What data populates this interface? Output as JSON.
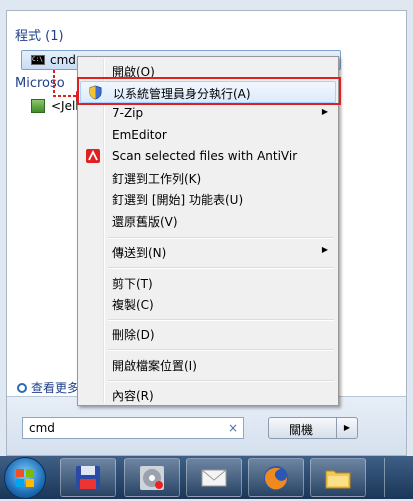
{
  "start_menu": {
    "programs_heading": "程式 (1)",
    "result_item": {
      "icon": "cmd-icon",
      "icon_text": "C:\\",
      "label": "cmd"
    },
    "files_heading_partial": "Microso",
    "file_item_partial": "<Jell",
    "see_more_partial": "查看更多",
    "search": {
      "value": "cmd",
      "clear_symbol": "×"
    },
    "shutdown": {
      "label": "關機",
      "arrow": "▶"
    }
  },
  "context_menu": {
    "items": [
      {
        "label": "開啟(O)",
        "icon": ""
      },
      {
        "label": "以系統管理員身分執行(A)",
        "icon": "shield-icon",
        "highlight": true
      },
      {
        "label": "7-Zip",
        "submenu": true
      },
      {
        "label": "EmEditor"
      },
      {
        "label": "Scan selected files with AntiVir",
        "icon": "antivir-icon"
      },
      {
        "label": "釘選到工作列(K)"
      },
      {
        "label": "釘選到 [開始] 功能表(U)"
      },
      {
        "label": "還原舊版(V)"
      },
      {
        "label": "傳送到(N)",
        "submenu": true
      },
      {
        "label": "剪下(T)"
      },
      {
        "label": "複製(C)"
      },
      {
        "label": "刪除(D)"
      },
      {
        "label": "開啟檔案位置(I)"
      },
      {
        "label": "內容(R)"
      }
    ],
    "submenu_arrow": "▶"
  },
  "colors": {
    "highlight_border": "#e02020",
    "heading_blue": "#1e3f8a",
    "taskbar": "#1a3658"
  },
  "taskbar": {
    "buttons": [
      {
        "icon": "windows-orb-icon"
      },
      {
        "icon": "floppy-disk-icon"
      },
      {
        "icon": "cd-drive-icon"
      },
      {
        "icon": "mail-envelope-icon"
      },
      {
        "icon": "firefox-icon"
      },
      {
        "icon": "folder-icon"
      }
    ]
  }
}
